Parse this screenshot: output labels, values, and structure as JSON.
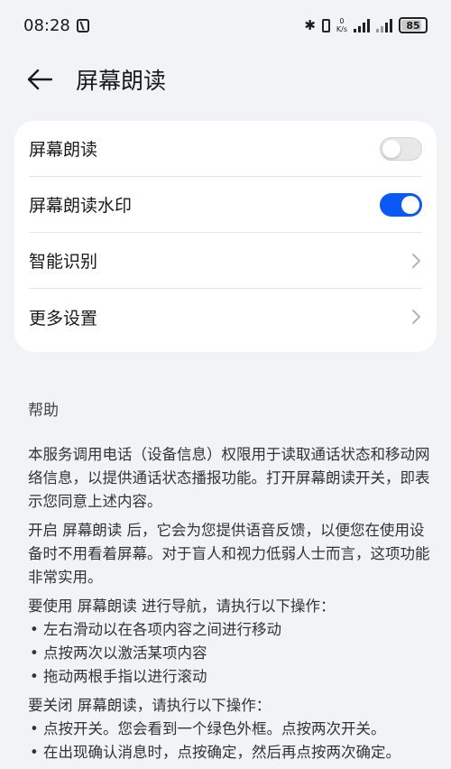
{
  "status_bar": {
    "time": "08:28",
    "speed_value": "0",
    "speed_unit": "K/s",
    "battery": "85",
    "battery_level_percent": 85
  },
  "header": {
    "title": "屏幕朗读"
  },
  "settings": {
    "items": [
      {
        "label": "屏幕朗读",
        "control": "toggle",
        "on": false
      },
      {
        "label": "屏幕朗读水印",
        "control": "toggle",
        "on": true
      },
      {
        "label": "智能识别",
        "control": "chevron"
      },
      {
        "label": "更多设置",
        "control": "chevron"
      }
    ]
  },
  "colors": {
    "accent": "#0a59f7",
    "background": "#f1f3f5",
    "card": "#ffffff"
  },
  "help": {
    "heading": "帮助",
    "p1": "本服务调用电话（设备信息）权限用于读取通话状态和移动网络信息，以提供通话状态播报功能。打开屏幕朗读开关，即表示您同意上述内容。",
    "p2": "开启 屏幕朗读 后，它会为您提供语音反馈，以便您在使用设备时不用看着屏幕。对于盲人和视力低弱人士而言，这项功能非常实用。",
    "p3": "要使用 屏幕朗读 进行导航，请执行以下操作：",
    "b1": "• 左右滑动以在各项内容之间进行移动",
    "b2": "• 点按两次以激活某项内容",
    "b3": "• 拖动两根手指以进行滚动",
    "p4": "要关闭 屏幕朗读，请执行以下操作：",
    "b4": "• 点按开关。您会看到一个绿色外框。点按两次开关。",
    "b5": "• 在出现确认消息时，点按确定，然后再点按两次确定。"
  }
}
